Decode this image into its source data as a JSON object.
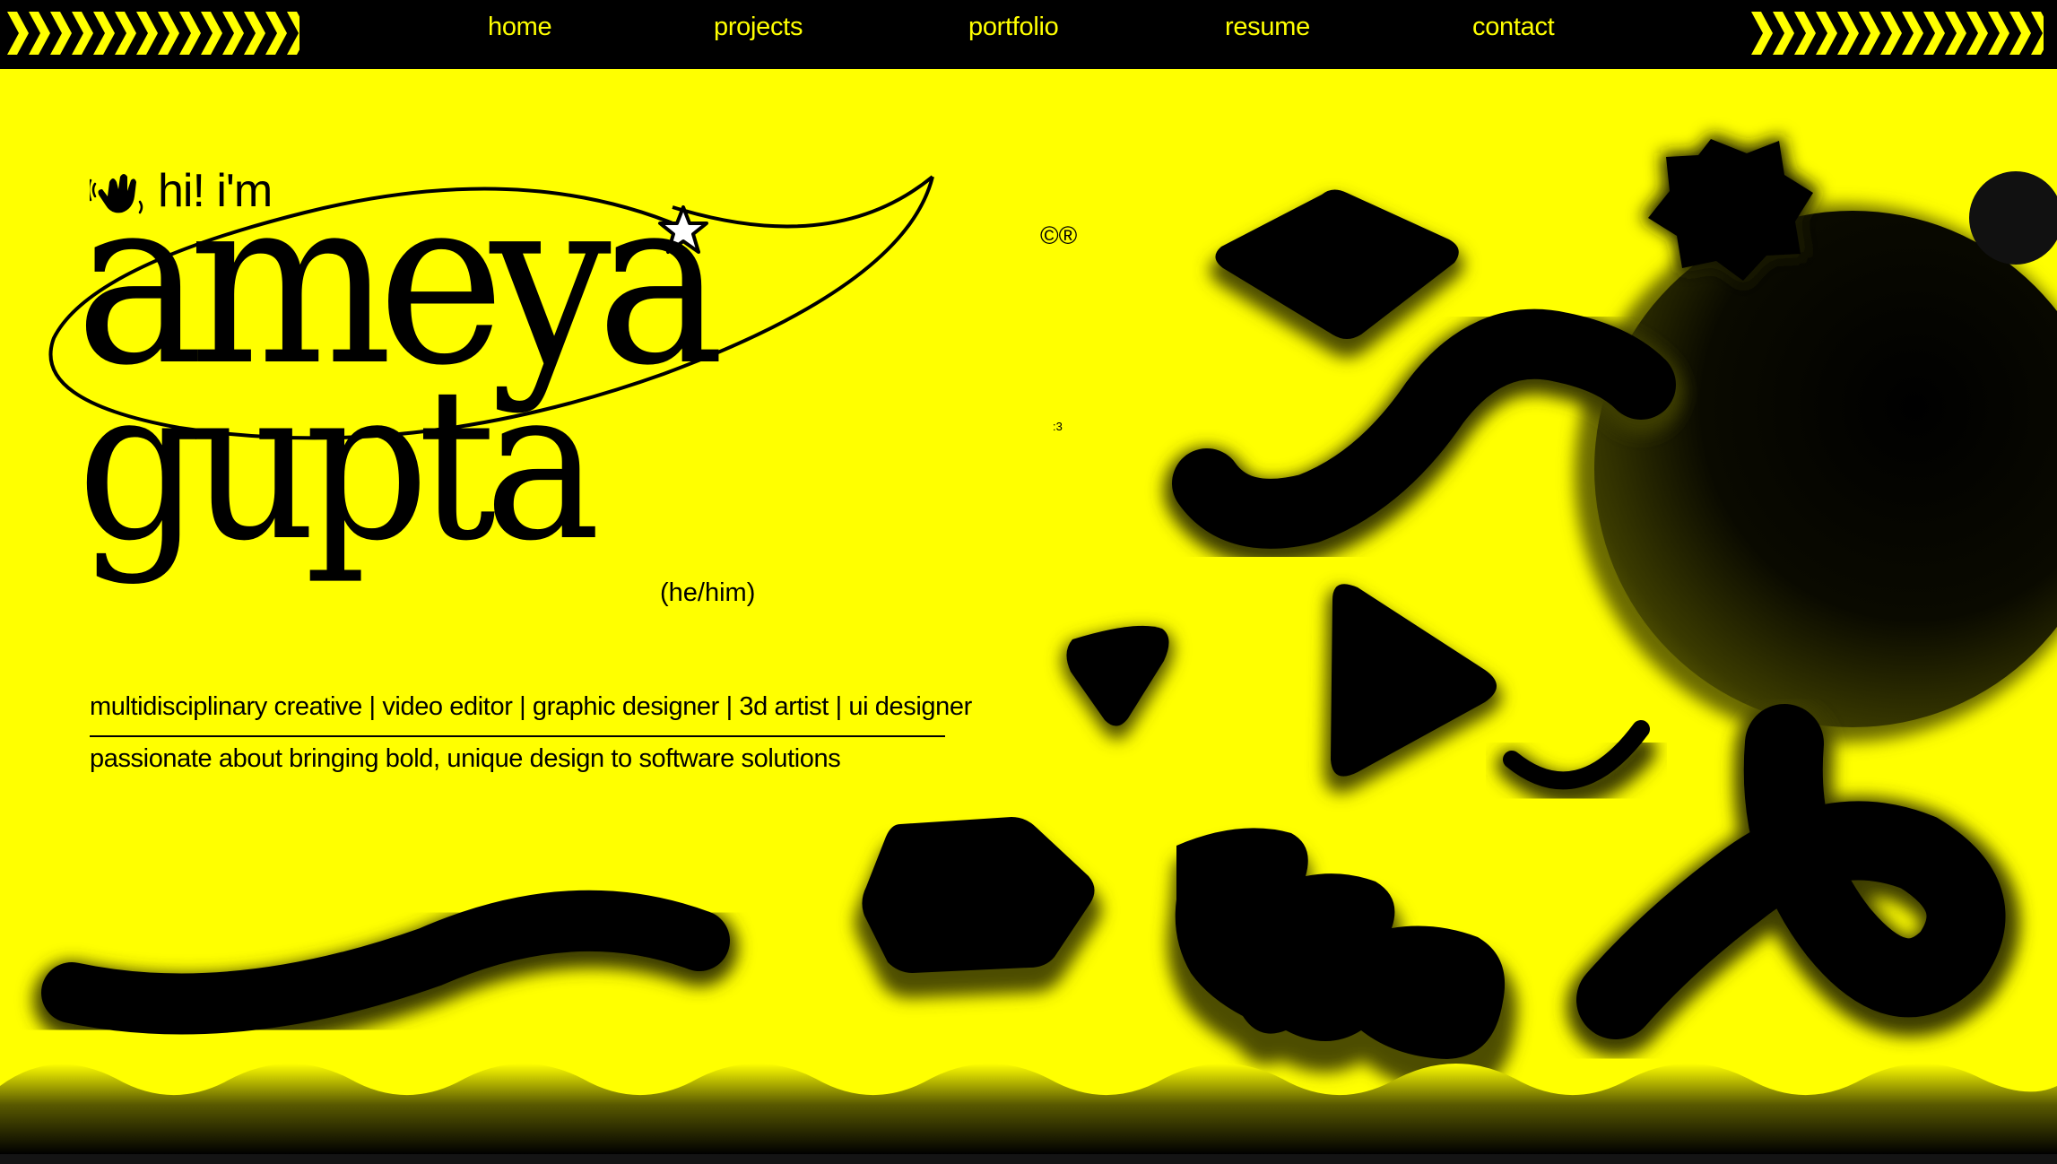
{
  "nav": {
    "links": [
      "home",
      "projects",
      "portfolio",
      "resume",
      "contact"
    ],
    "background": "#000000",
    "accent": "#ffff00"
  },
  "hero": {
    "background": "#ffff00",
    "greeting": "hi! i'm",
    "greeting_icon": "waving-hand-icon",
    "first_name": "ameya",
    "last_name": "gupta",
    "trademark": "©®",
    "smiley": ":3",
    "pronouns": "(he/him)",
    "roles": "multidisciplinary creative | video editor | graphic designer | 3d artist | ui designer",
    "tagline": "passionate about bringing bold, unique design to software solutions",
    "decor_icons": [
      "star-icon",
      "chevron-stripe-icon"
    ]
  }
}
